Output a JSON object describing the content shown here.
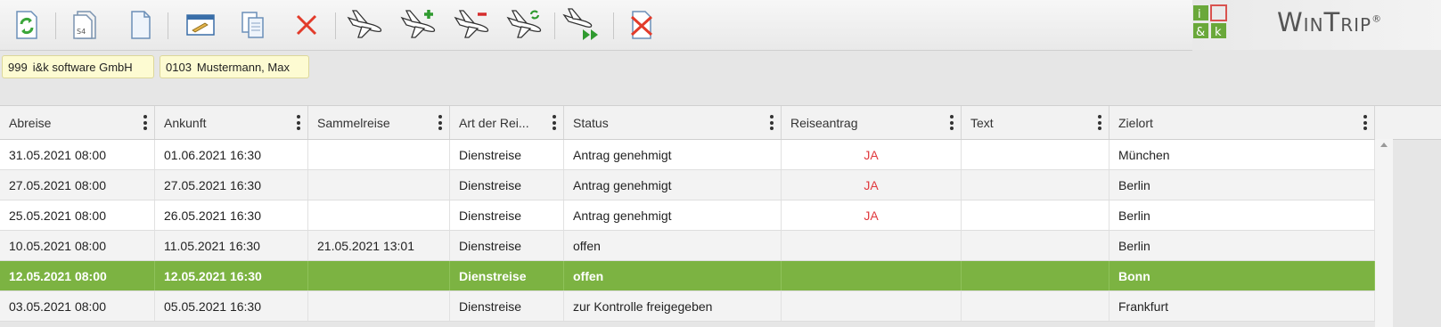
{
  "toolbar": {
    "buttons": [
      {
        "name": "refresh-button",
        "icon": "refresh-icon"
      },
      {
        "name": "document-s4-button",
        "icon": "document-s4-icon"
      },
      {
        "name": "new-document-button",
        "icon": "new-document-icon"
      },
      {
        "name": "edit-form-button",
        "icon": "edit-form-icon"
      },
      {
        "name": "copy-button",
        "icon": "copy-icon"
      },
      {
        "name": "delete-button",
        "icon": "close-icon"
      },
      {
        "name": "trip-button",
        "icon": "airplane-icon"
      },
      {
        "name": "add-trip-button",
        "icon": "airplane-plus-icon"
      },
      {
        "name": "remove-trip-button",
        "icon": "airplane-minus-icon"
      },
      {
        "name": "refresh-trip-button",
        "icon": "airplane-refresh-icon"
      },
      {
        "name": "forward-trip-button",
        "icon": "airplane-forward-icon"
      },
      {
        "name": "cancel-document-button",
        "icon": "document-cancel-icon"
      }
    ]
  },
  "logo": {
    "box_top_left": "i",
    "box_bottom_left": "&",
    "box_bottom_right": "k",
    "text": "WinTrip",
    "trademark": "®"
  },
  "context": {
    "company": {
      "code": "999",
      "name": "i&k software GmbH"
    },
    "employee": {
      "code": "0103",
      "name": "Mustermann, Max"
    }
  },
  "table": {
    "columns": [
      "Abreise",
      "Ankunft",
      "Sammelreise",
      "Art der Rei...",
      "Status",
      "Reiseantrag",
      "Text",
      "Zielort"
    ],
    "rows": [
      {
        "abreise": "31.05.2021 08:00",
        "ankunft": "01.06.2021 16:30",
        "sammelreise": "",
        "art": "Dienstreise",
        "status": "Antrag genehmigt",
        "reiseantrag": "JA",
        "text": "",
        "zielort": "München",
        "selected": false
      },
      {
        "abreise": "27.05.2021 08:00",
        "ankunft": "27.05.2021 16:30",
        "sammelreise": "",
        "art": "Dienstreise",
        "status": "Antrag genehmigt",
        "reiseantrag": "JA",
        "text": "",
        "zielort": "Berlin",
        "selected": false
      },
      {
        "abreise": "25.05.2021 08:00",
        "ankunft": "26.05.2021 16:30",
        "sammelreise": "",
        "art": "Dienstreise",
        "status": "Antrag genehmigt",
        "reiseantrag": "JA",
        "text": "",
        "zielort": "Berlin",
        "selected": false
      },
      {
        "abreise": "10.05.2021 08:00",
        "ankunft": "11.05.2021 16:30",
        "sammelreise": "21.05.2021 13:01",
        "art": "Dienstreise",
        "status": "offen",
        "reiseantrag": "",
        "text": "",
        "zielort": "Berlin",
        "selected": false
      },
      {
        "abreise": "12.05.2021 08:00",
        "ankunft": "12.05.2021 16:30",
        "sammelreise": "",
        "art": "Dienstreise",
        "status": "offen",
        "reiseantrag": "",
        "text": "",
        "zielort": "Bonn",
        "selected": true
      },
      {
        "abreise": "03.05.2021 08:00",
        "ankunft": "05.05.2021 16:30",
        "sammelreise": "",
        "art": "Dienstreise",
        "status": "zur Kontrolle freigegeben",
        "reiseantrag": "",
        "text": "",
        "zielort": "Frankfurt",
        "selected": false
      }
    ]
  },
  "colors": {
    "selected_row": "#7cb342",
    "ja_text": "#e0393e",
    "chip_bg": "#fdfbd2",
    "logo_green": "#6aa83a",
    "logo_red": "#d9534f"
  }
}
